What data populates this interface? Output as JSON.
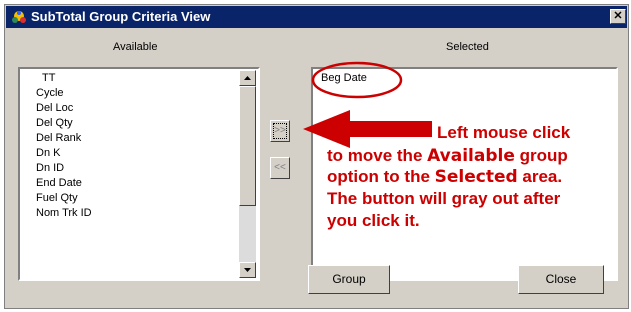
{
  "window": {
    "title": "SubTotal Group Criteria View",
    "close_glyph": "✕"
  },
  "available": {
    "header": "Available",
    "items": [
      "TT",
      "Cycle",
      "Del Loc",
      "Del Qty",
      "Del Rank",
      "Dn K",
      "Dn ID",
      "End Date",
      "Fuel Qty",
      "Nom Trk ID"
    ]
  },
  "selected": {
    "header": "Selected",
    "items": [
      "Beg Date"
    ]
  },
  "buttons": {
    "move_right": ">>",
    "move_left": "<<",
    "group": "Group",
    "close": "Close"
  },
  "annotation": {
    "line1": "Left mouse click",
    "line2_pre": "to move the ",
    "line2_em": "Available",
    "line2_post": " group",
    "line3_pre": "option to the ",
    "line3_em": "Selected",
    "line3_post": " area.",
    "line4": "The button will gray out after",
    "line5": "you click it.",
    "color": "#cc0000"
  }
}
